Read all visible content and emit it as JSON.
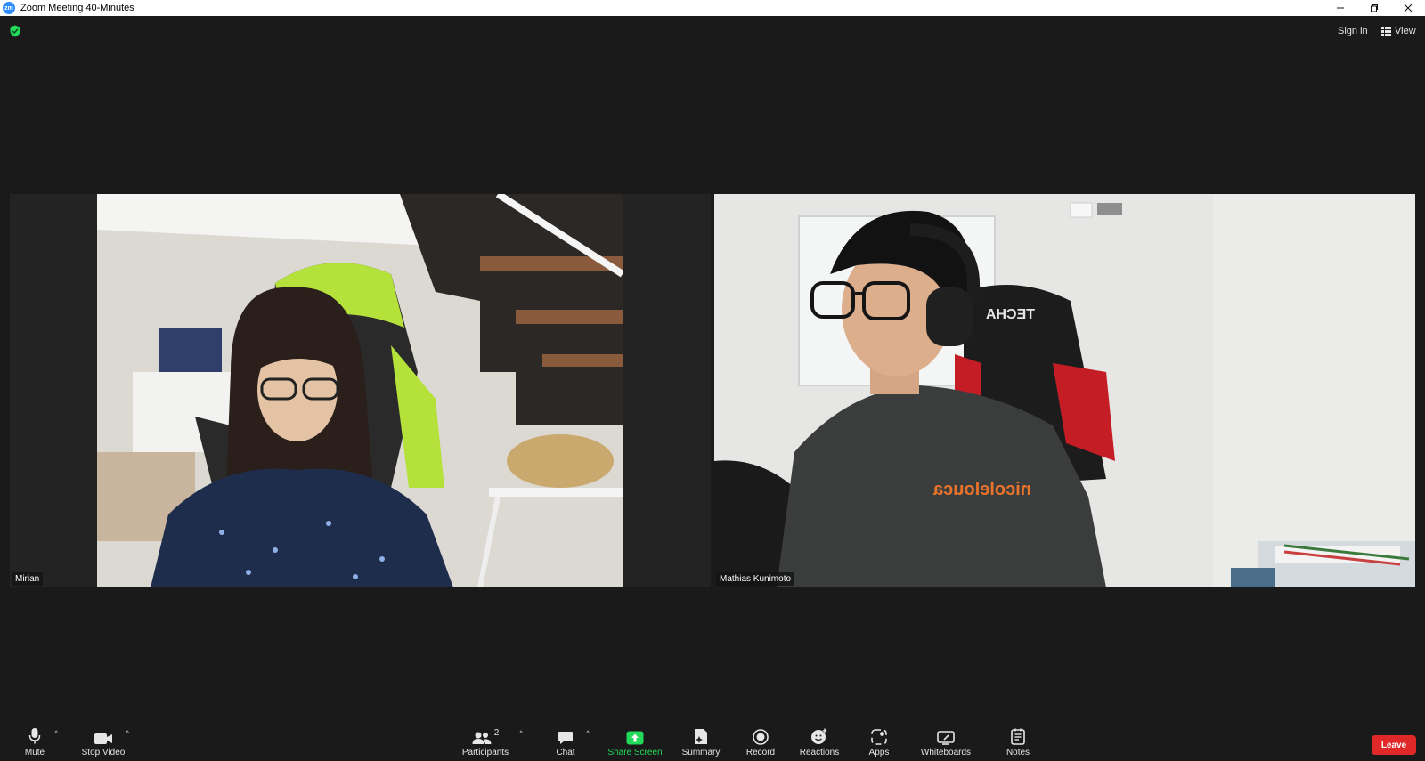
{
  "window": {
    "title": "Zoom Meeting 40-Minutes",
    "app_icon_text": "zm",
    "controls": [
      "minimize-icon",
      "restore-icon",
      "close-icon"
    ]
  },
  "topbar": {
    "sign_in": "Sign in",
    "view": "View",
    "security_icon": "shield-check-icon",
    "security_color": "#23d959"
  },
  "participants": [
    {
      "name": "Mirian"
    },
    {
      "name": "Mathias Kunimoto",
      "shirt_text": "nicolelouca",
      "chair_text": "TECHA"
    }
  ],
  "toolbar": {
    "mute": "Mute",
    "stop_video": "Stop Video",
    "participants": "Participants",
    "participants_count": "2",
    "chat": "Chat",
    "share_screen": "Share Screen",
    "summary": "Summary",
    "record": "Record",
    "reactions": "Reactions",
    "apps": "Apps",
    "whiteboards": "Whiteboards",
    "notes": "Notes",
    "leave": "Leave",
    "share_color": "#23d959",
    "leave_color": "#e02828"
  }
}
